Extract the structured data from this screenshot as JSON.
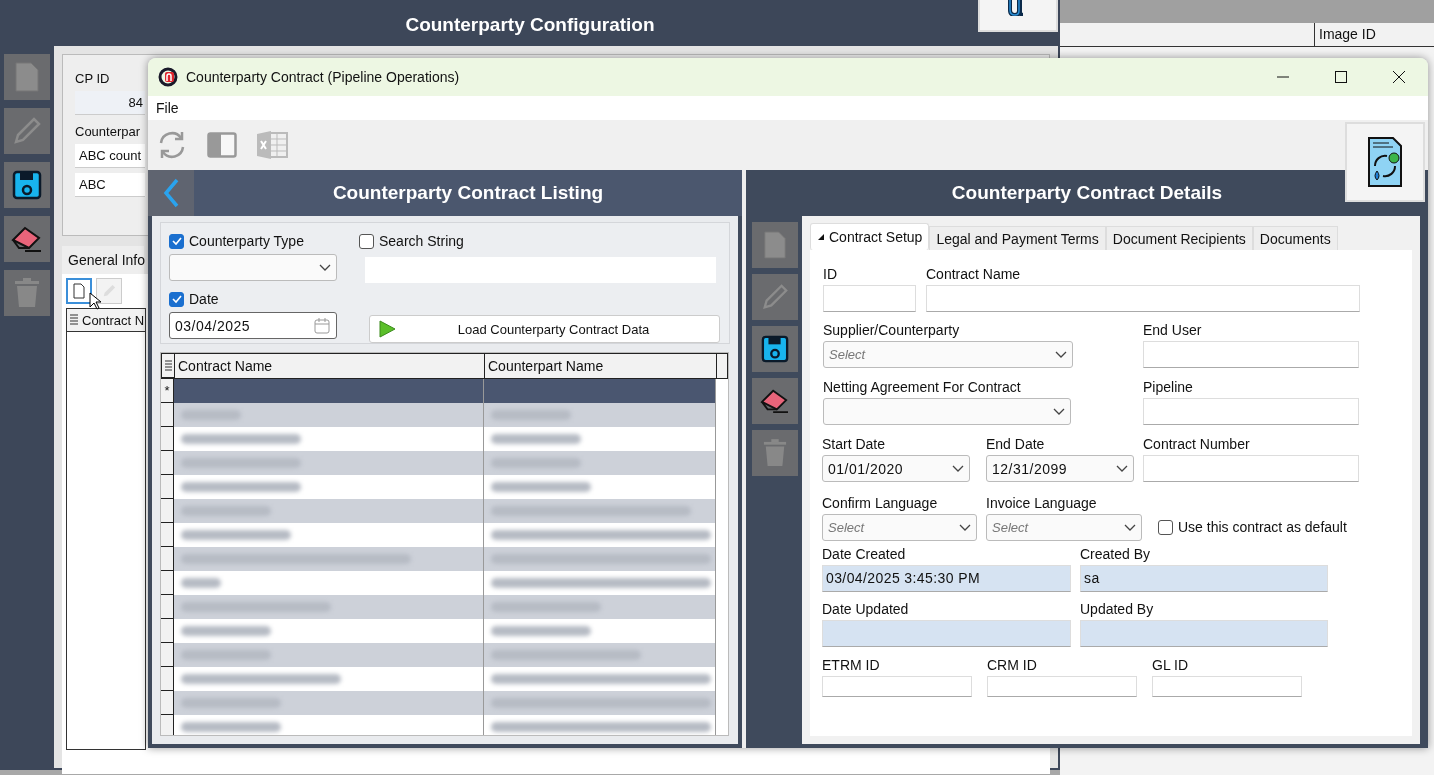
{
  "background_window": {
    "title": "Counterparty Configuration",
    "cp_id_label": "CP ID",
    "cp_id_value": "84",
    "counterparty_label": "Counterpar",
    "name_value": "ABC count",
    "short_value": "ABC",
    "tab": "General Info",
    "grid_column": "Contract N"
  },
  "background_grid": {
    "column": "Image ID"
  },
  "window": {
    "title": "Counterparty Contract (Pipeline Operations)"
  },
  "menu": [
    "File"
  ],
  "listing": {
    "title": "Counterparty Contract Listing",
    "counterparty_type": {
      "label": "Counterparty Type",
      "checked": true
    },
    "search_string": {
      "label": "Search String",
      "checked": false
    },
    "date": {
      "label": "Date",
      "checked": true,
      "value": "03/04/2025"
    },
    "load_button": "Load Counterparty Contract Data",
    "columns": [
      "Contract Name",
      "Counterpart Name"
    ],
    "new_row_marker": "*",
    "rows": [
      {
        "redacted": true
      },
      {
        "redacted": true
      },
      {
        "redacted": true
      },
      {
        "redacted": true
      },
      {
        "redacted": true
      },
      {
        "redacted": true
      },
      {
        "redacted": true
      },
      {
        "redacted": true
      },
      {
        "redacted": true
      },
      {
        "redacted": true
      },
      {
        "redacted": true
      },
      {
        "redacted": true
      },
      {
        "redacted": true
      },
      {
        "redacted": true
      }
    ]
  },
  "details": {
    "title": "Counterparty Contract Details",
    "tabs": [
      {
        "label": "Contract Setup",
        "selected": true
      },
      {
        "label": "Legal and Payment Terms",
        "selected": false
      },
      {
        "label": "Document Recipients",
        "selected": false
      },
      {
        "label": "Documents",
        "selected": false
      }
    ],
    "fields": {
      "id": {
        "label": "ID",
        "kind": "text"
      },
      "contract_name": {
        "label": "Contract Name",
        "kind": "text"
      },
      "supplier": {
        "label": "Supplier/Counterparty",
        "kind": "select",
        "placeholder": "Select"
      },
      "end_user": {
        "label": "End User",
        "kind": "text"
      },
      "netting": {
        "label": "Netting Agreement For Contract",
        "kind": "select"
      },
      "pipeline": {
        "label": "Pipeline",
        "kind": "text"
      },
      "start_date": {
        "label": "Start Date",
        "kind": "select",
        "value": "01/01/2020"
      },
      "end_date": {
        "label": "End Date",
        "kind": "select",
        "value": "12/31/2099"
      },
      "contract_number": {
        "label": "Contract Number",
        "kind": "text"
      },
      "confirm_language": {
        "label": "Confirm Language",
        "kind": "select",
        "placeholder": "Select"
      },
      "invoice_language": {
        "label": "Invoice Language",
        "kind": "select",
        "placeholder": "Select"
      },
      "use_default": {
        "label": "Use this contract as default",
        "kind": "checkbox",
        "checked": false
      },
      "date_created": {
        "label": "Date Created",
        "kind": "text",
        "read_only": true,
        "value": "03/04/2025 3:45:30 PM"
      },
      "created_by": {
        "label": "Created By",
        "kind": "text",
        "read_only": true,
        "value": "sa"
      },
      "date_updated": {
        "label": "Date Updated",
        "kind": "text",
        "read_only": true
      },
      "updated_by": {
        "label": "Updated By",
        "kind": "text",
        "read_only": true
      },
      "etrm_id": {
        "label": "ETRM ID",
        "kind": "text"
      },
      "crm_id": {
        "label": "CRM ID",
        "kind": "text"
      },
      "gl_id": {
        "label": "GL ID",
        "kind": "text"
      }
    }
  }
}
